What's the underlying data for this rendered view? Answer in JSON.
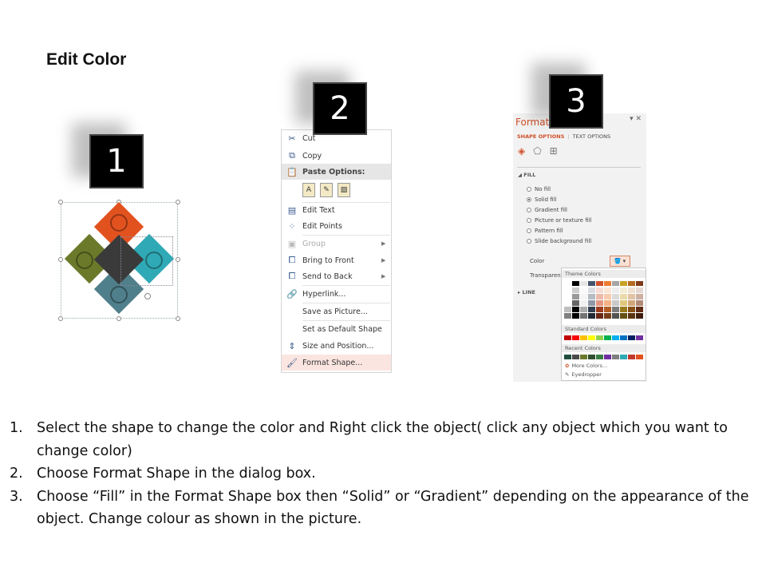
{
  "title": "Edit Color",
  "badges": [
    "1",
    "2",
    "3"
  ],
  "shapes": {
    "colors": [
      "#e2521f",
      "#6b7a2a",
      "#3a3a3a",
      "#2fa9b5",
      "#4f7f8a"
    ]
  },
  "context_menu": {
    "items": [
      {
        "icon": "scissors-icon",
        "glyph": "✂",
        "label": "Cut"
      },
      {
        "icon": "copy-icon",
        "glyph": "⧉",
        "label": "Copy"
      },
      {
        "icon": "clipboard-icon",
        "glyph": "📋",
        "label": "Paste Options:"
      },
      {
        "icon": "edit-text-icon",
        "glyph": "▤",
        "label": "Edit Text"
      },
      {
        "icon": "edit-points-icon",
        "glyph": "⁘",
        "label": "Edit Points"
      },
      {
        "icon": "group-icon",
        "glyph": "▣",
        "label": "Group"
      },
      {
        "icon": "bring-front-icon",
        "glyph": "⧠",
        "label": "Bring to Front"
      },
      {
        "icon": "send-back-icon",
        "glyph": "⧠",
        "label": "Send to Back"
      },
      {
        "icon": "hyperlink-icon",
        "glyph": "🔗",
        "label": "Hyperlink..."
      },
      {
        "icon": "",
        "glyph": "",
        "label": "Save as Picture..."
      },
      {
        "icon": "",
        "glyph": "",
        "label": "Set as Default Shape"
      },
      {
        "icon": "size-position-icon",
        "glyph": "⇕",
        "label": "Size and Position..."
      },
      {
        "icon": "format-shape-icon",
        "glyph": "🖌",
        "label": "Format Shape..."
      }
    ]
  },
  "format_pane": {
    "title": "Format",
    "close": "▾ ✕",
    "tab_shape": "SHAPE OPTIONS",
    "tab_text": "TEXT OPTIONS",
    "fill_section": "◢ FILL",
    "fill_options": [
      "No fill",
      "Solid fill",
      "Gradient fill",
      "Picture or texture fill",
      "Pattern fill",
      "Slide background fill"
    ],
    "color_label": "Color",
    "transparency_label": "Transparency",
    "line_section": "▸ LINE",
    "palette": {
      "theme_label": "Theme Colors",
      "standard_label": "Standard Colors",
      "recent_label": "Recent Colors",
      "more_colors": "More Colors...",
      "eyedropper": "Eyedropper",
      "theme_top": [
        "#ffffff",
        "#000000",
        "#e7e6e6",
        "#44546a",
        "#d0502a",
        "#ed7d31",
        "#a5a5a5",
        "#c9a227",
        "#b46a1e",
        "#7f3b1a"
      ],
      "standard": [
        "#c00000",
        "#ff0000",
        "#ffc000",
        "#ffff00",
        "#92d050",
        "#00b050",
        "#00b0f0",
        "#0070c0",
        "#002060",
        "#7030a0"
      ],
      "recent": [
        "#1f4e3d",
        "#4a4a4a",
        "#6b7a2a",
        "#2f4f2f",
        "#3a7d44",
        "#7030a0",
        "#7f7f7f",
        "#2fa9b5",
        "#c0392b",
        "#e2521f"
      ]
    }
  },
  "steps": [
    {
      "n": "1.",
      "text": "Select the shape to change the color and Right click the object( click any object which you want to change color)"
    },
    {
      "n": "2.",
      "text": "Choose Format Shape in the dialog box."
    },
    {
      "n": "3.",
      "text": "Choose “Fill” in the Format Shape box then “Solid” or “Gradient” depending on the appearance of the object. Change colour as shown in the picture."
    }
  ]
}
